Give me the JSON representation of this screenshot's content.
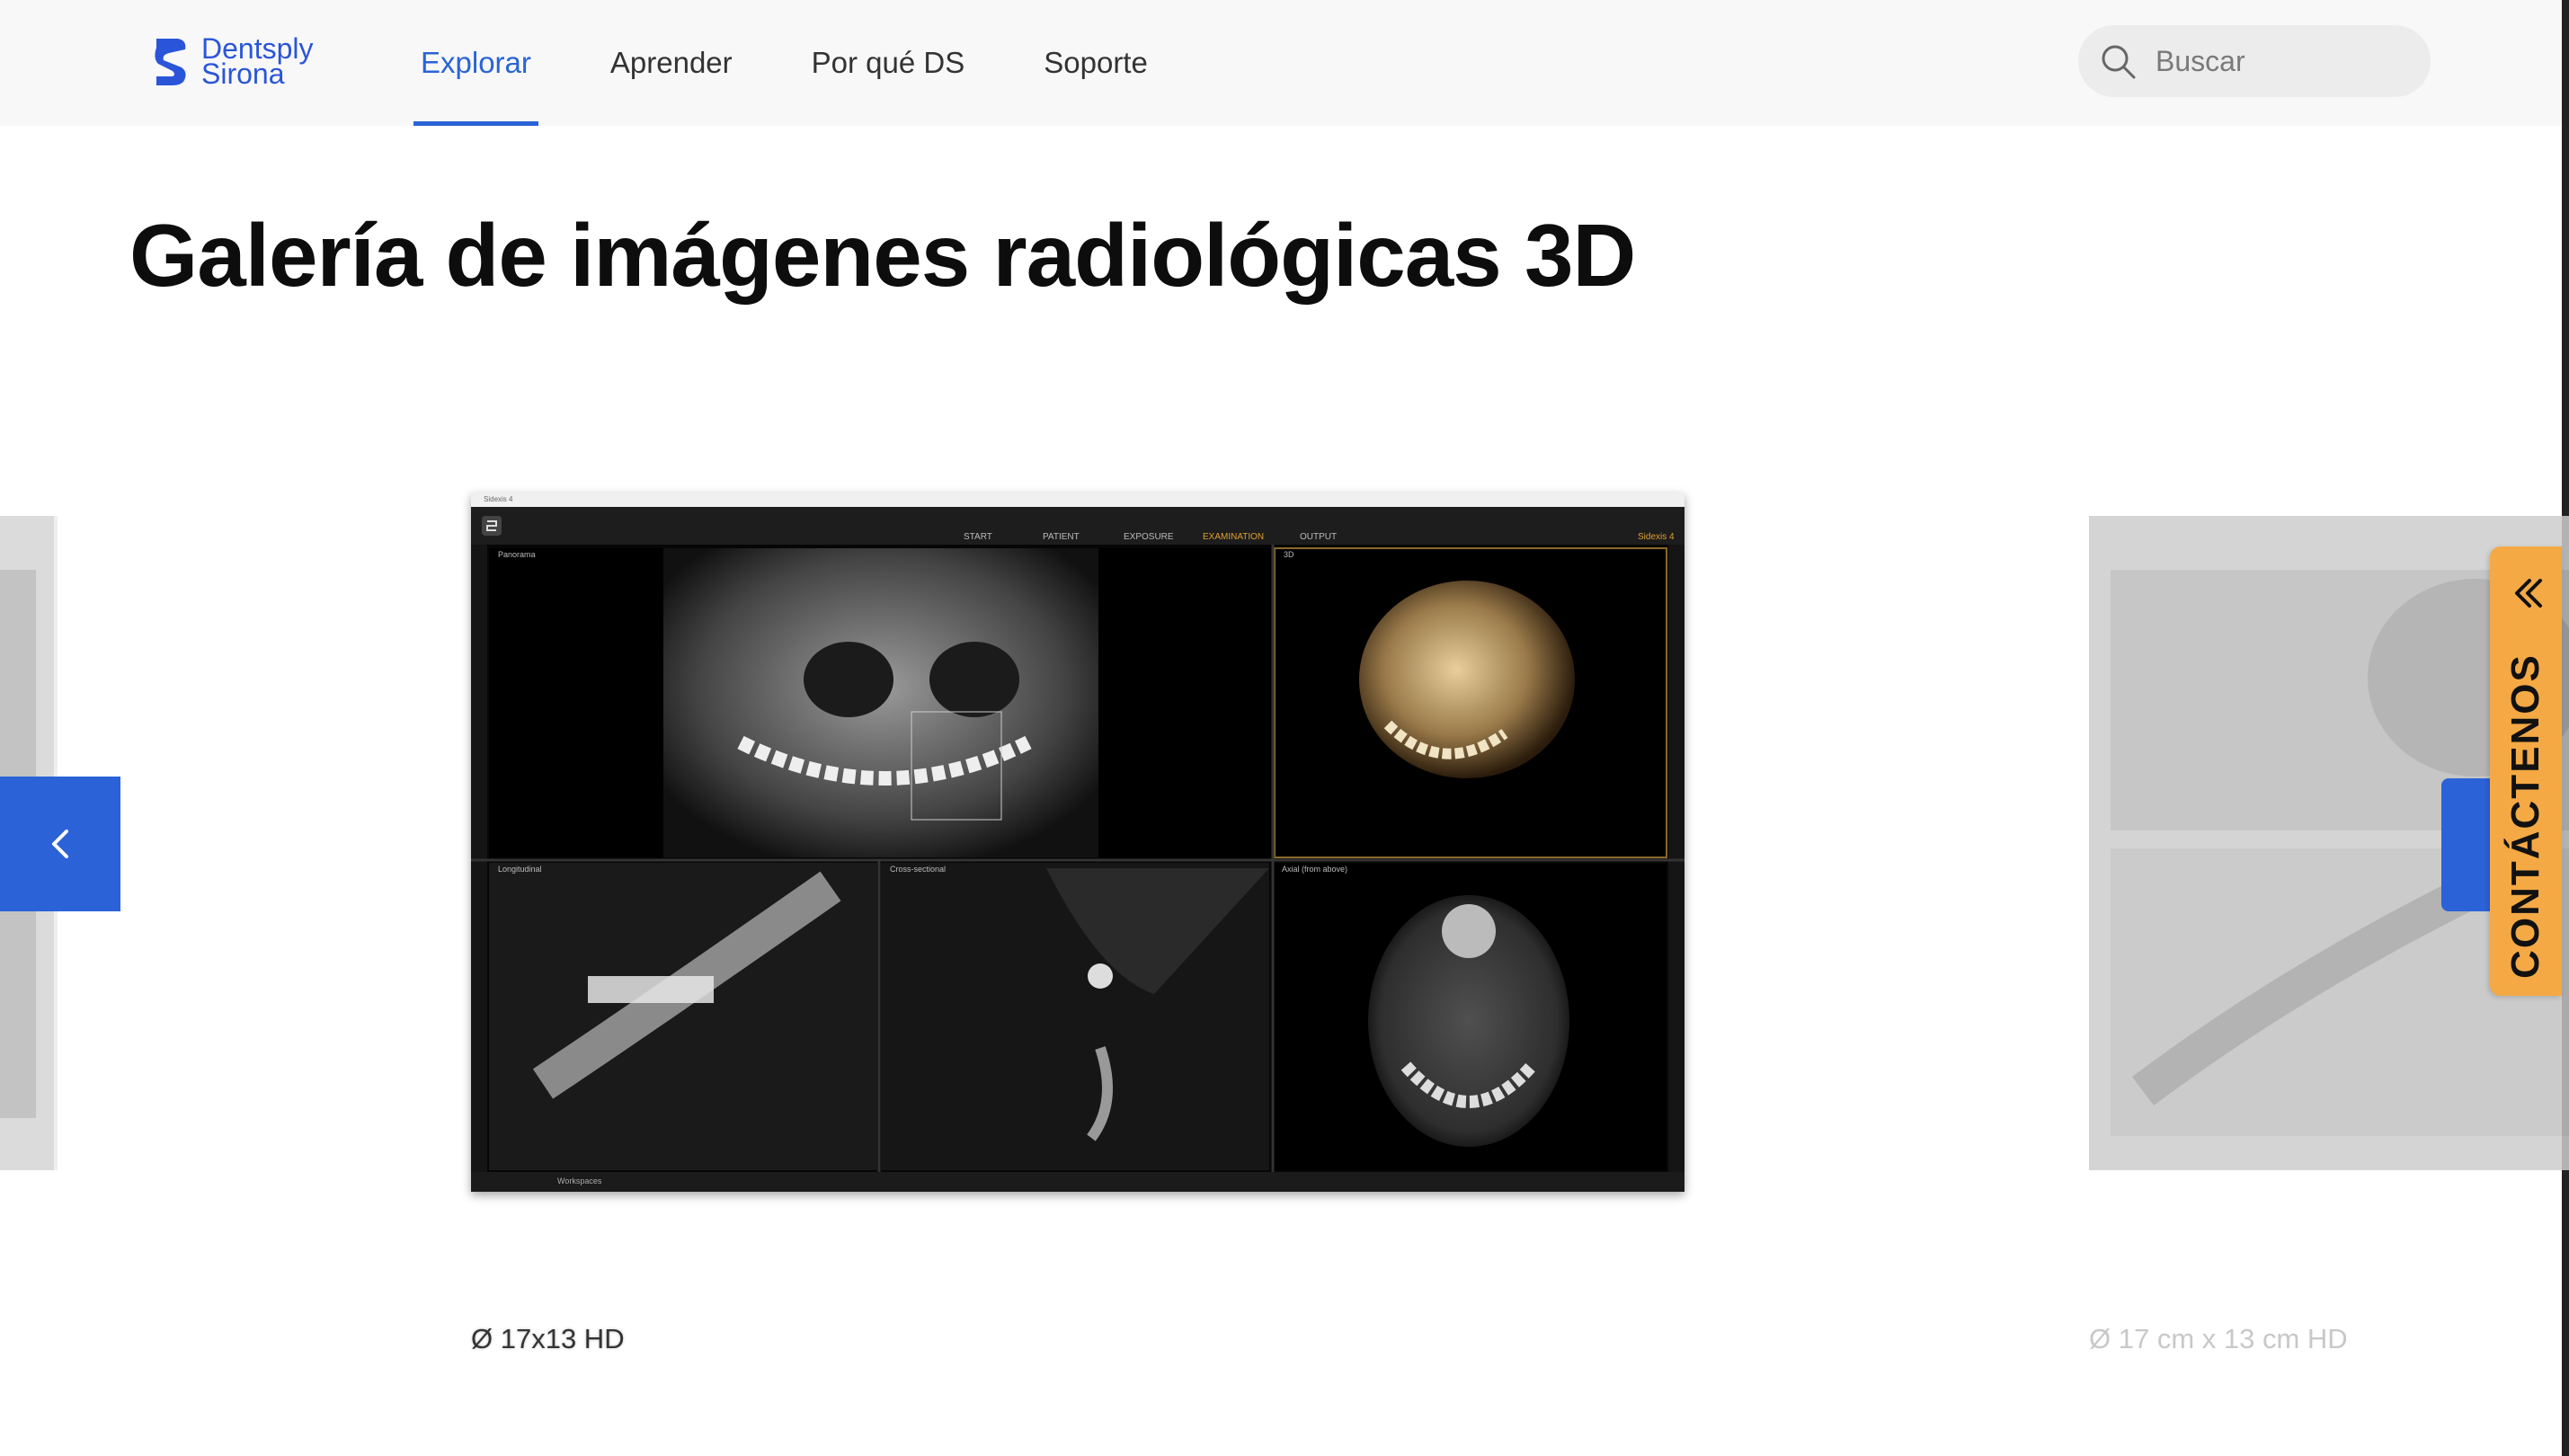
{
  "header": {
    "logo": {
      "line1": "Dentsply",
      "line2": "Sirona"
    },
    "nav": [
      {
        "label": "Explorar",
        "active": true
      },
      {
        "label": "Aprender",
        "active": false
      },
      {
        "label": "Por qué DS",
        "active": false
      },
      {
        "label": "Soporte",
        "active": false
      }
    ],
    "search": {
      "placeholder": "Buscar"
    }
  },
  "page": {
    "title": "Galería de imágenes radiológicas 3D"
  },
  "carousel": {
    "current_caption": "Ø 17x13 HD",
    "next_caption": "Ø 17 cm x 13 cm HD",
    "prev_icon": "chevron-left-icon"
  },
  "xray_app": {
    "window_title": "Sidexis 4",
    "steps": [
      "START",
      "PATIENT",
      "EXPOSURE",
      "EXAMINATION",
      "OUTPUT"
    ],
    "active_step": "EXAMINATION",
    "brand": "Sidexis 4",
    "panels": [
      "Panorama",
      "3D",
      "Longitudinal",
      "Cross-sectional",
      "Axial (from above)"
    ],
    "footer": "Workspaces"
  },
  "contact": {
    "label": "CONTÁCTENOS",
    "icon": "double-chevron-icon"
  },
  "colors": {
    "brand_blue": "#2c62d8",
    "nav_active": "#2a63d6",
    "contact_orange": "#f4a945"
  }
}
